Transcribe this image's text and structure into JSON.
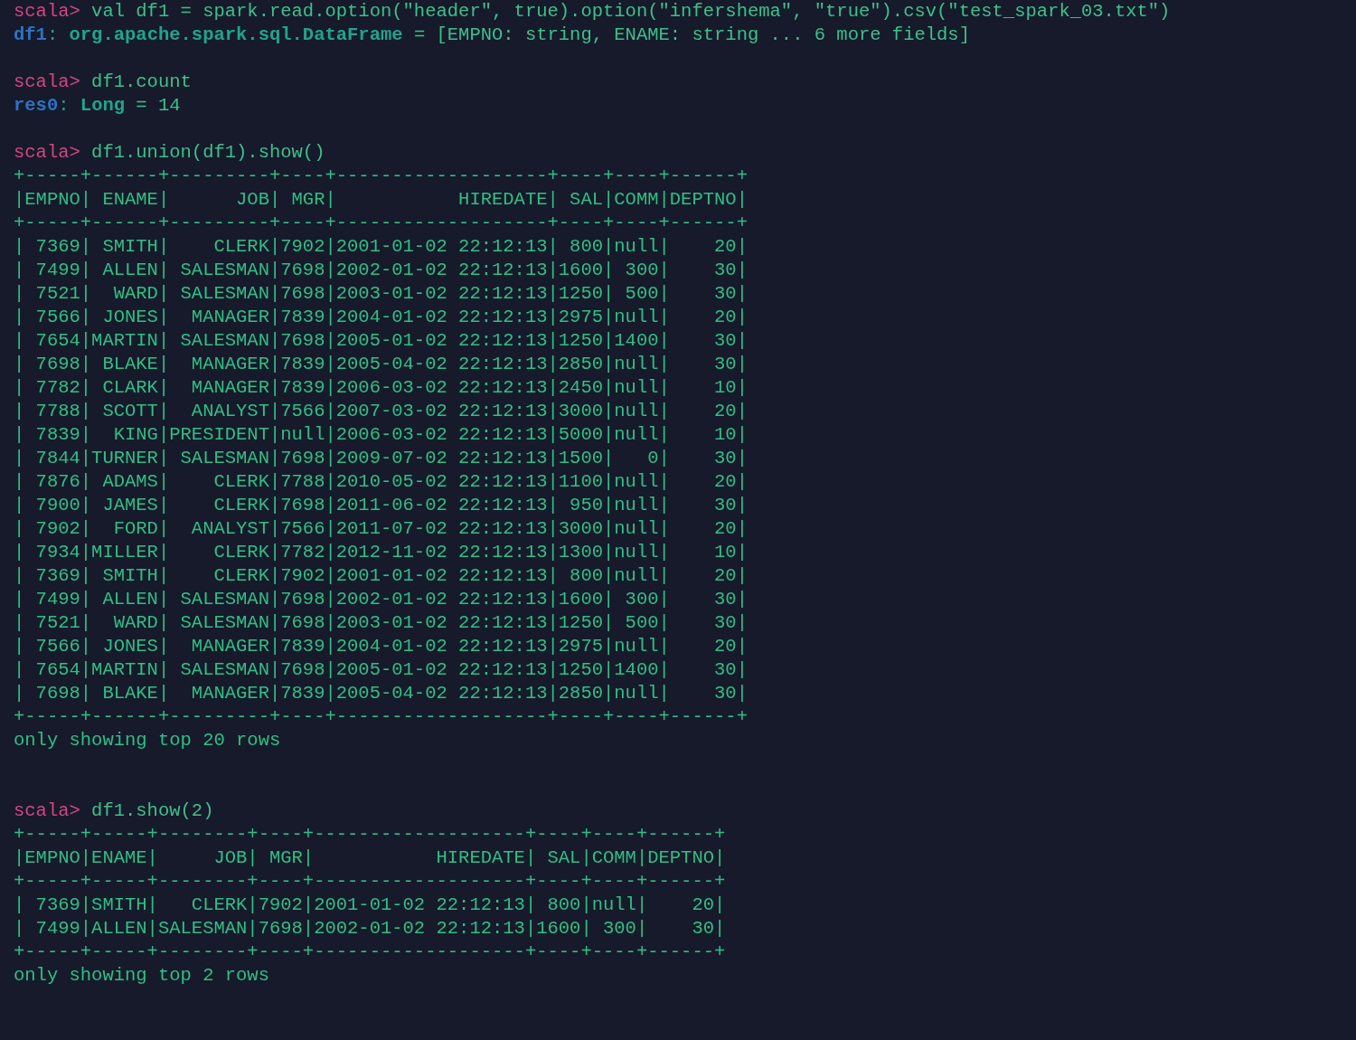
{
  "terminal": {
    "lines": [
      {
        "kind": "prompt",
        "prompt": "scala>",
        "command": "val df1 = spark.read.option(\"header\", true).option(\"infershema\", \"true\").csv(\"test_spark_03.txt\")"
      },
      {
        "kind": "result",
        "name": "df1",
        "separator": ":",
        "type": "org.apache.spark.sql.DataFrame",
        "value": "= [EMPNO: string, ENAME: string ... 6 more fields]"
      },
      {
        "kind": "blank"
      },
      {
        "kind": "prompt",
        "prompt": "scala>",
        "command": "df1.count"
      },
      {
        "kind": "result",
        "name": "res0",
        "separator": ":",
        "type": "Long",
        "value": "= 14"
      },
      {
        "kind": "blank"
      },
      {
        "kind": "prompt",
        "prompt": "scala>",
        "command": "df1.union(df1).show()"
      },
      {
        "kind": "output",
        "text": "+-----+------+---------+----+-------------------+----+----+------+"
      },
      {
        "kind": "output",
        "text": "|EMPNO| ENAME|      JOB| MGR|           HIREDATE| SAL|COMM|DEPTNO|"
      },
      {
        "kind": "output",
        "text": "+-----+------+---------+----+-------------------+----+----+------+"
      },
      {
        "kind": "output",
        "text": "| 7369| SMITH|    CLERK|7902|2001-01-02 22:12:13| 800|null|    20|"
      },
      {
        "kind": "output",
        "text": "| 7499| ALLEN| SALESMAN|7698|2002-01-02 22:12:13|1600| 300|    30|"
      },
      {
        "kind": "output",
        "text": "| 7521|  WARD| SALESMAN|7698|2003-01-02 22:12:13|1250| 500|    30|"
      },
      {
        "kind": "output",
        "text": "| 7566| JONES|  MANAGER|7839|2004-01-02 22:12:13|2975|null|    20|"
      },
      {
        "kind": "output",
        "text": "| 7654|MARTIN| SALESMAN|7698|2005-01-02 22:12:13|1250|1400|    30|"
      },
      {
        "kind": "output",
        "text": "| 7698| BLAKE|  MANAGER|7839|2005-04-02 22:12:13|2850|null|    30|"
      },
      {
        "kind": "output",
        "text": "| 7782| CLARK|  MANAGER|7839|2006-03-02 22:12:13|2450|null|    10|"
      },
      {
        "kind": "output",
        "text": "| 7788| SCOTT|  ANALYST|7566|2007-03-02 22:12:13|3000|null|    20|"
      },
      {
        "kind": "output",
        "text": "| 7839|  KING|PRESIDENT|null|2006-03-02 22:12:13|5000|null|    10|"
      },
      {
        "kind": "output",
        "text": "| 7844|TURNER| SALESMAN|7698|2009-07-02 22:12:13|1500|   0|    30|"
      },
      {
        "kind": "output",
        "text": "| 7876| ADAMS|    CLERK|7788|2010-05-02 22:12:13|1100|null|    20|"
      },
      {
        "kind": "output",
        "text": "| 7900| JAMES|    CLERK|7698|2011-06-02 22:12:13| 950|null|    30|"
      },
      {
        "kind": "output",
        "text": "| 7902|  FORD|  ANALYST|7566|2011-07-02 22:12:13|3000|null|    20|"
      },
      {
        "kind": "output",
        "text": "| 7934|MILLER|    CLERK|7782|2012-11-02 22:12:13|1300|null|    10|"
      },
      {
        "kind": "output",
        "text": "| 7369| SMITH|    CLERK|7902|2001-01-02 22:12:13| 800|null|    20|"
      },
      {
        "kind": "output",
        "text": "| 7499| ALLEN| SALESMAN|7698|2002-01-02 22:12:13|1600| 300|    30|"
      },
      {
        "kind": "output",
        "text": "| 7521|  WARD| SALESMAN|7698|2003-01-02 22:12:13|1250| 500|    30|"
      },
      {
        "kind": "output",
        "text": "| 7566| JONES|  MANAGER|7839|2004-01-02 22:12:13|2975|null|    20|"
      },
      {
        "kind": "output",
        "text": "| 7654|MARTIN| SALESMAN|7698|2005-01-02 22:12:13|1250|1400|    30|"
      },
      {
        "kind": "output",
        "text": "| 7698| BLAKE|  MANAGER|7839|2005-04-02 22:12:13|2850|null|    30|"
      },
      {
        "kind": "output",
        "text": "+-----+------+---------+----+-------------------+----+----+------+"
      },
      {
        "kind": "output",
        "text": "only showing top 20 rows"
      },
      {
        "kind": "blank"
      },
      {
        "kind": "blank"
      },
      {
        "kind": "prompt",
        "prompt": "scala>",
        "command": "df1.show(2)"
      },
      {
        "kind": "output",
        "text": "+-----+-----+--------+----+-------------------+----+----+------+"
      },
      {
        "kind": "output",
        "text": "|EMPNO|ENAME|     JOB| MGR|           HIREDATE| SAL|COMM|DEPTNO|"
      },
      {
        "kind": "output",
        "text": "+-----+-----+--------+----+-------------------+----+----+------+"
      },
      {
        "kind": "output",
        "text": "| 7369|SMITH|   CLERK|7902|2001-01-02 22:12:13| 800|null|    20|"
      },
      {
        "kind": "output",
        "text": "| 7499|ALLEN|SALESMAN|7698|2002-01-02 22:12:13|1600| 300|    30|"
      },
      {
        "kind": "output",
        "text": "+-----+-----+--------+----+-------------------+----+----+------+"
      },
      {
        "kind": "output",
        "text": "only showing top 2 rows"
      }
    ]
  }
}
